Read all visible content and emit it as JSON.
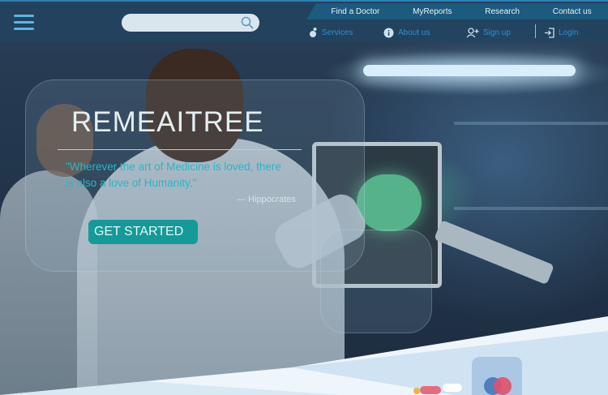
{
  "search": {
    "value": "",
    "placeholder": ""
  },
  "nav_top": {
    "items": [
      "Find a Doctor",
      "MyReports",
      "Research",
      "Contact us"
    ]
  },
  "nav_sub": {
    "services": "Services",
    "about": "About us",
    "signup": "Sign up",
    "login": "Login"
  },
  "hero": {
    "title": "REMEAITREE",
    "quote": "\"Wherever the art of Medicine is loved, there is also a love of Humanity.\"",
    "author": "— Hippocrates",
    "cta_label": "GET STARTED"
  },
  "icons": {
    "menu": "hamburger-icon",
    "search": "search-icon",
    "services": "services-icon",
    "about": "info-icon",
    "signup": "user-plus-icon",
    "login": "login-icon"
  },
  "colors": {
    "accent": "#2e8fd2",
    "quote": "#28b6c9",
    "cta": "#159a98",
    "nav_bar": "#1c5a7e"
  }
}
